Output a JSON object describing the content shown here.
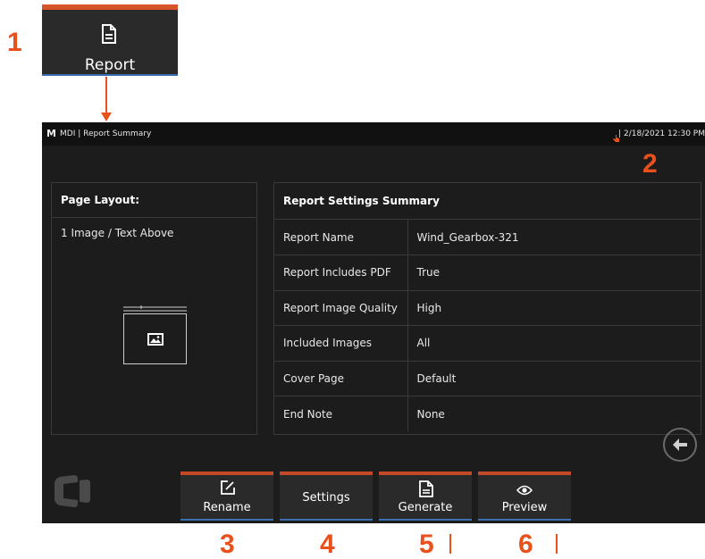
{
  "callouts": {
    "c1": "1",
    "c2": "2",
    "c3": "3",
    "c4": "4",
    "c5": "5",
    "c6": "6"
  },
  "report_button": {
    "label": "Report",
    "icon": "document-icon"
  },
  "topbar": {
    "logo": "M",
    "app_title": "MDI | Report Summary",
    "datetime": "| 2/18/2021 12:30 PM",
    "status_icon": "touch-icon"
  },
  "page_layout": {
    "title": "Page Layout:",
    "value": "1 Image / Text Above"
  },
  "summary": {
    "title": "Report Settings Summary",
    "rows": [
      {
        "key": "Report Name",
        "value": "Wind_Gearbox-321"
      },
      {
        "key": "Report Includes PDF",
        "value": "True"
      },
      {
        "key": "Report Image Quality",
        "value": "High"
      },
      {
        "key": "Included Images",
        "value": "All"
      },
      {
        "key": "Cover Page",
        "value": "Default"
      },
      {
        "key": "End Note",
        "value": "None"
      }
    ]
  },
  "toolbar": {
    "rename_label": "Rename",
    "settings_label": "Settings",
    "generate_label": "Generate",
    "preview_label": "Preview"
  },
  "colors": {
    "accent": "#e8501c",
    "screen_bg": "#1c1c1c",
    "button_top": "#c24a28"
  }
}
